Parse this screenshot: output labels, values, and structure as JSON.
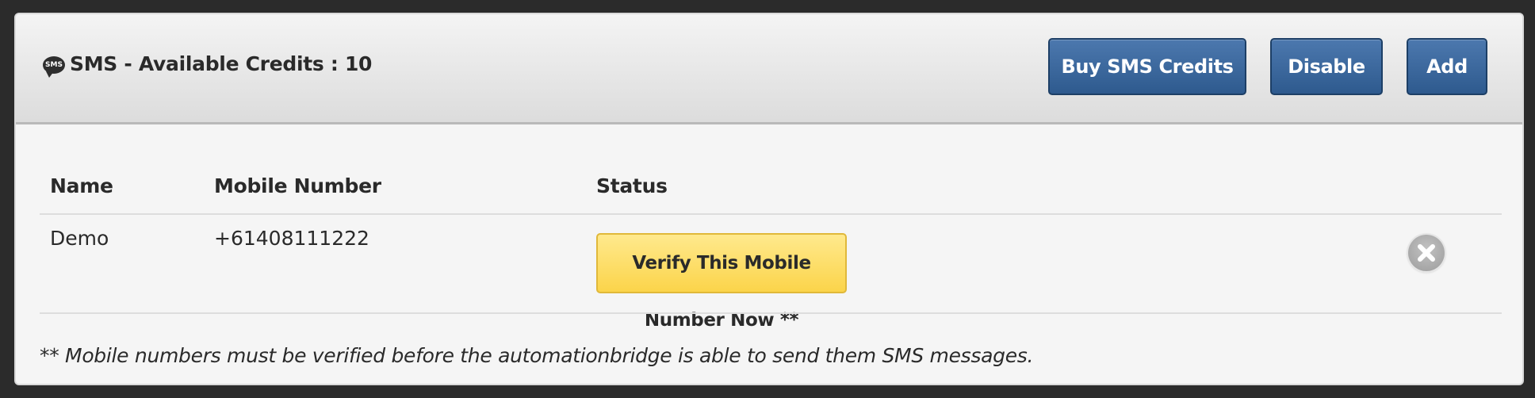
{
  "panel": {
    "icon": "sms-bubble-icon",
    "icon_text": "SMS",
    "title": "SMS - Available Credits : 10",
    "buttons": {
      "buy": "Buy SMS Credits",
      "disable": "Disable",
      "add": "Add"
    }
  },
  "table": {
    "headers": [
      "Name",
      "Mobile Number",
      "Status"
    ],
    "rows": [
      {
        "name": "Demo",
        "mobile": "+61408111222",
        "status_button": "Verify This Mobile Number Now **",
        "remove_icon": "remove-circle-icon"
      }
    ]
  },
  "footnote": "** Mobile numbers must be verified before the automationbridge is able to send them SMS messages.",
  "colors": {
    "primary_button": "#2e5a8e",
    "warning_button": "#fbd44a",
    "background": "#2b2b2b",
    "panel": "#f5f5f5"
  }
}
